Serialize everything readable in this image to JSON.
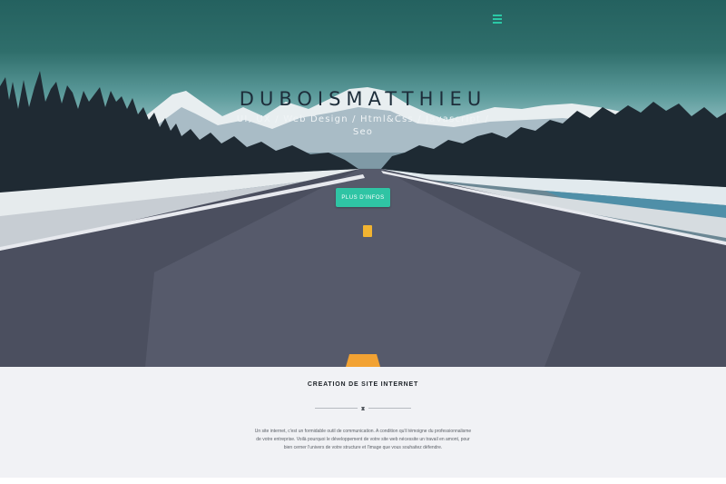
{
  "hero": {
    "menu_icon": "hamburger-icon",
    "title": "DUBOISMATTHIEU",
    "subtitle": "UI, UX / Web Design / Html&Css / Javascript / Seo",
    "cta_label": "PLUS D'INFOS",
    "accent_color": "#2fc4a4"
  },
  "section": {
    "title": "CREATION DE SITE INTERNET",
    "divider_icon": "ornament-icon",
    "text": "Un site internet, c'est un formidable outil de communication. A condition qu'il témoigne du professionnalisme de votre entreprise. Voilà pourquoi le développement de votre site web nécessite un travail en amont, pour bien cerner l'univers de votre structure et l'image que vous souhaitez défendre."
  }
}
